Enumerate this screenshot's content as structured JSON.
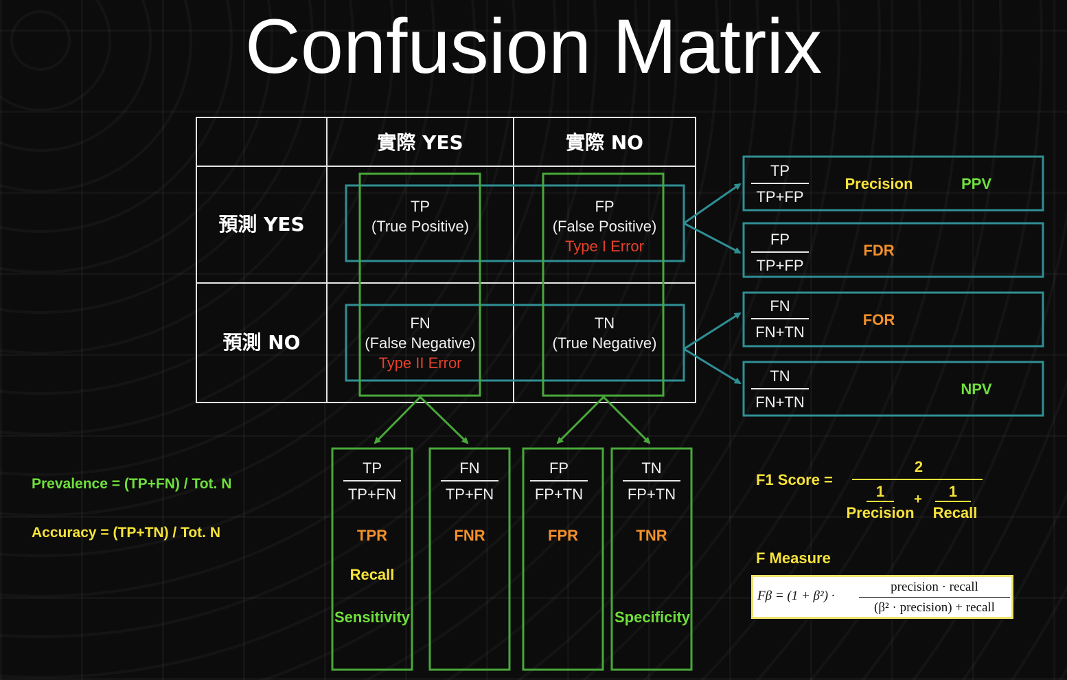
{
  "title": "Confusion Matrix",
  "matrix": {
    "col_actual_yes": "實際 YES",
    "col_actual_no": "實際 NO",
    "row_pred_yes": "預測 YES",
    "row_pred_no": "預測 NO",
    "tp": {
      "abbr": "TP",
      "name": "(True Positive)"
    },
    "fp": {
      "abbr": "FP",
      "name": "(False Positive)",
      "error": "Type I Error"
    },
    "fn": {
      "abbr": "FN",
      "name": "(False Negative)",
      "error": "Type II Error"
    },
    "tn": {
      "abbr": "TN",
      "name": "(True Negative)"
    }
  },
  "row_metrics": [
    {
      "num": "TP",
      "den": "TP+FP",
      "label": "Precision",
      "alt": "PPV"
    },
    {
      "num": "FP",
      "den": "TP+FP",
      "label": "FDR",
      "alt": ""
    },
    {
      "num": "FN",
      "den": "FN+TN",
      "label": "FOR",
      "alt": ""
    },
    {
      "num": "TN",
      "den": "FN+TN",
      "label": "",
      "alt": "NPV"
    }
  ],
  "col_metrics": [
    {
      "num": "TP",
      "den": "TP+FN",
      "label": "TPR",
      "alias1": "Recall",
      "alias2": "Sensitivity"
    },
    {
      "num": "FN",
      "den": "TP+FN",
      "label": "FNR",
      "alias1": "",
      "alias2": ""
    },
    {
      "num": "FP",
      "den": "FP+TN",
      "label": "FPR",
      "alias1": "",
      "alias2": ""
    },
    {
      "num": "TN",
      "den": "FP+TN",
      "label": "TNR",
      "alias1": "",
      "alias2": "Specificity"
    }
  ],
  "formulas": {
    "prevalence": "Prevalence = (TP+FN) / Tot. N",
    "accuracy": "Accuracy = (TP+TN) / Tot. N"
  },
  "f1": {
    "label": "F1 Score =",
    "numerator": "2",
    "term1_num": "1",
    "term1_den": "Precision",
    "plus": "+",
    "term2_num": "1",
    "term2_den": "Recall"
  },
  "f_measure": {
    "label": "F Measure",
    "lhs": "Fβ = (1 + β²) ·",
    "numerator": "precision · recall",
    "denominator": "(β² · precision) + recall"
  },
  "colors": {
    "background": "#0c0c0c",
    "teal": "#2f8f95",
    "green_box": "#49a83a",
    "yellow": "#f6e23a",
    "orange": "#f3902a",
    "green_text": "#6fe03c",
    "red": "#e5402a"
  }
}
